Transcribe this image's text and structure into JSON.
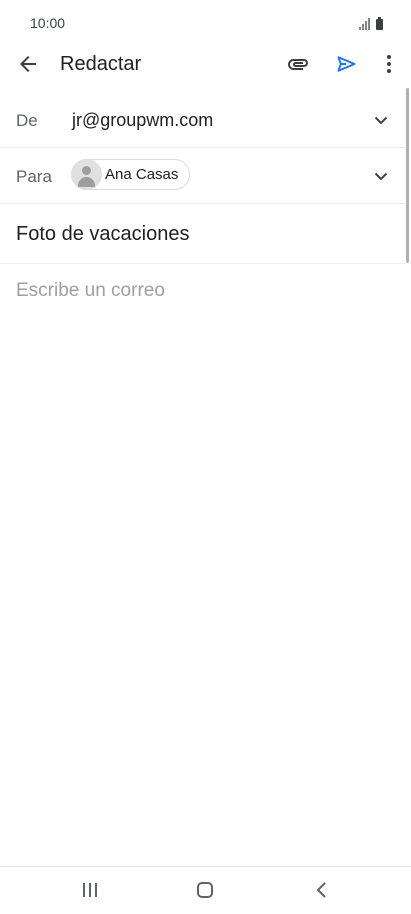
{
  "status_bar": {
    "time": "10:00"
  },
  "app_bar": {
    "title": "Redactar"
  },
  "compose": {
    "from_label": "De",
    "from_value": "jr@groupwm.com",
    "to_label": "Para",
    "to_recipient": "Ana Casas",
    "subject": "Foto de vacaciones",
    "body_placeholder": "Escribe un correo"
  },
  "colors": {
    "accent": "#1a73e8",
    "text_primary": "#202124",
    "text_secondary": "#5f6368",
    "placeholder": "#9aa0a6"
  },
  "icons": {
    "back": "arrow-left-icon",
    "attach": "paperclip-icon",
    "send": "send-icon",
    "more": "more-vert-icon",
    "expand": "chevron-down-icon",
    "avatar": "person-icon",
    "nav_recents": "recents-icon",
    "nav_home": "home-icon",
    "nav_back": "nav-back-icon"
  }
}
